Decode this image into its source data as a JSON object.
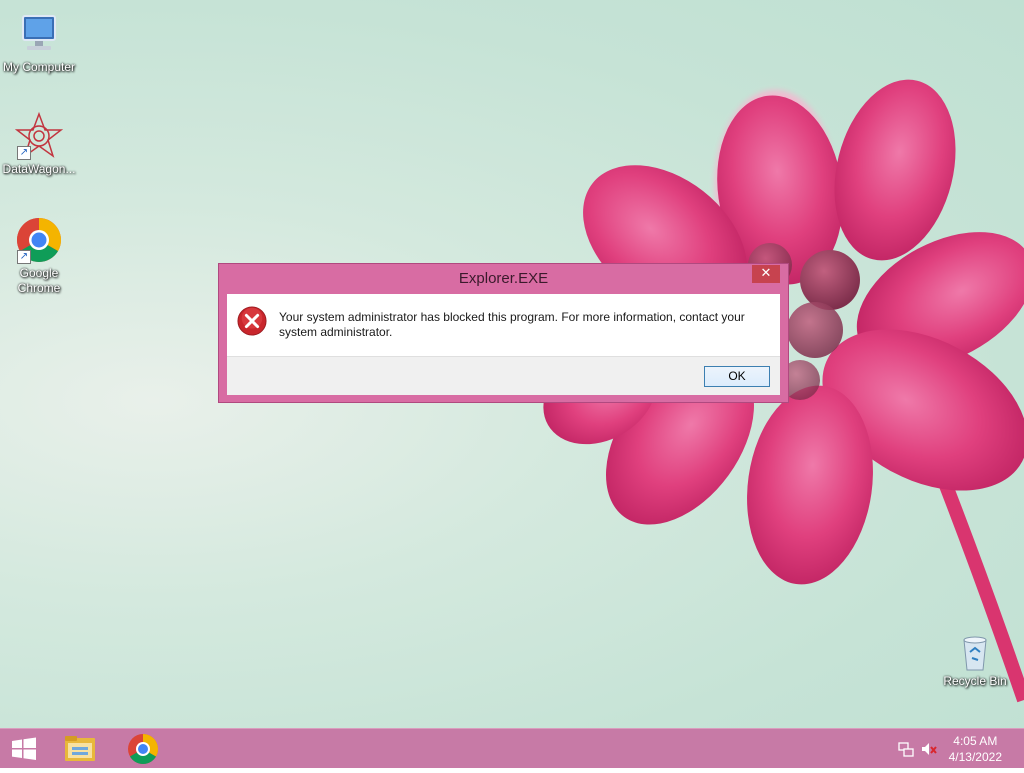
{
  "desktop": {
    "icons": [
      {
        "label": "My Computer"
      },
      {
        "label": "DataWagon..."
      },
      {
        "label": "Google Chrome"
      },
      {
        "label": "Recycle Bin"
      }
    ]
  },
  "dialog": {
    "title": "Explorer.EXE",
    "close_glyph": "✕",
    "message": "Your system administrator has blocked this program. For more information, contact your system administrator.",
    "ok_label": "OK",
    "icon": "error-icon"
  },
  "taskbar": {
    "pinned": [
      "windows-start-icon",
      "file-explorer-icon",
      "chrome-icon"
    ],
    "tray_icons": [
      "network-icon",
      "volume-muted-icon"
    ],
    "time": "4:05 AM",
    "date": "4/13/2022"
  },
  "colors": {
    "taskbar": "#c77aa6",
    "dialog_frame": "#d86ca3",
    "close_button": "#c7434f",
    "flower": "#e0407e"
  }
}
